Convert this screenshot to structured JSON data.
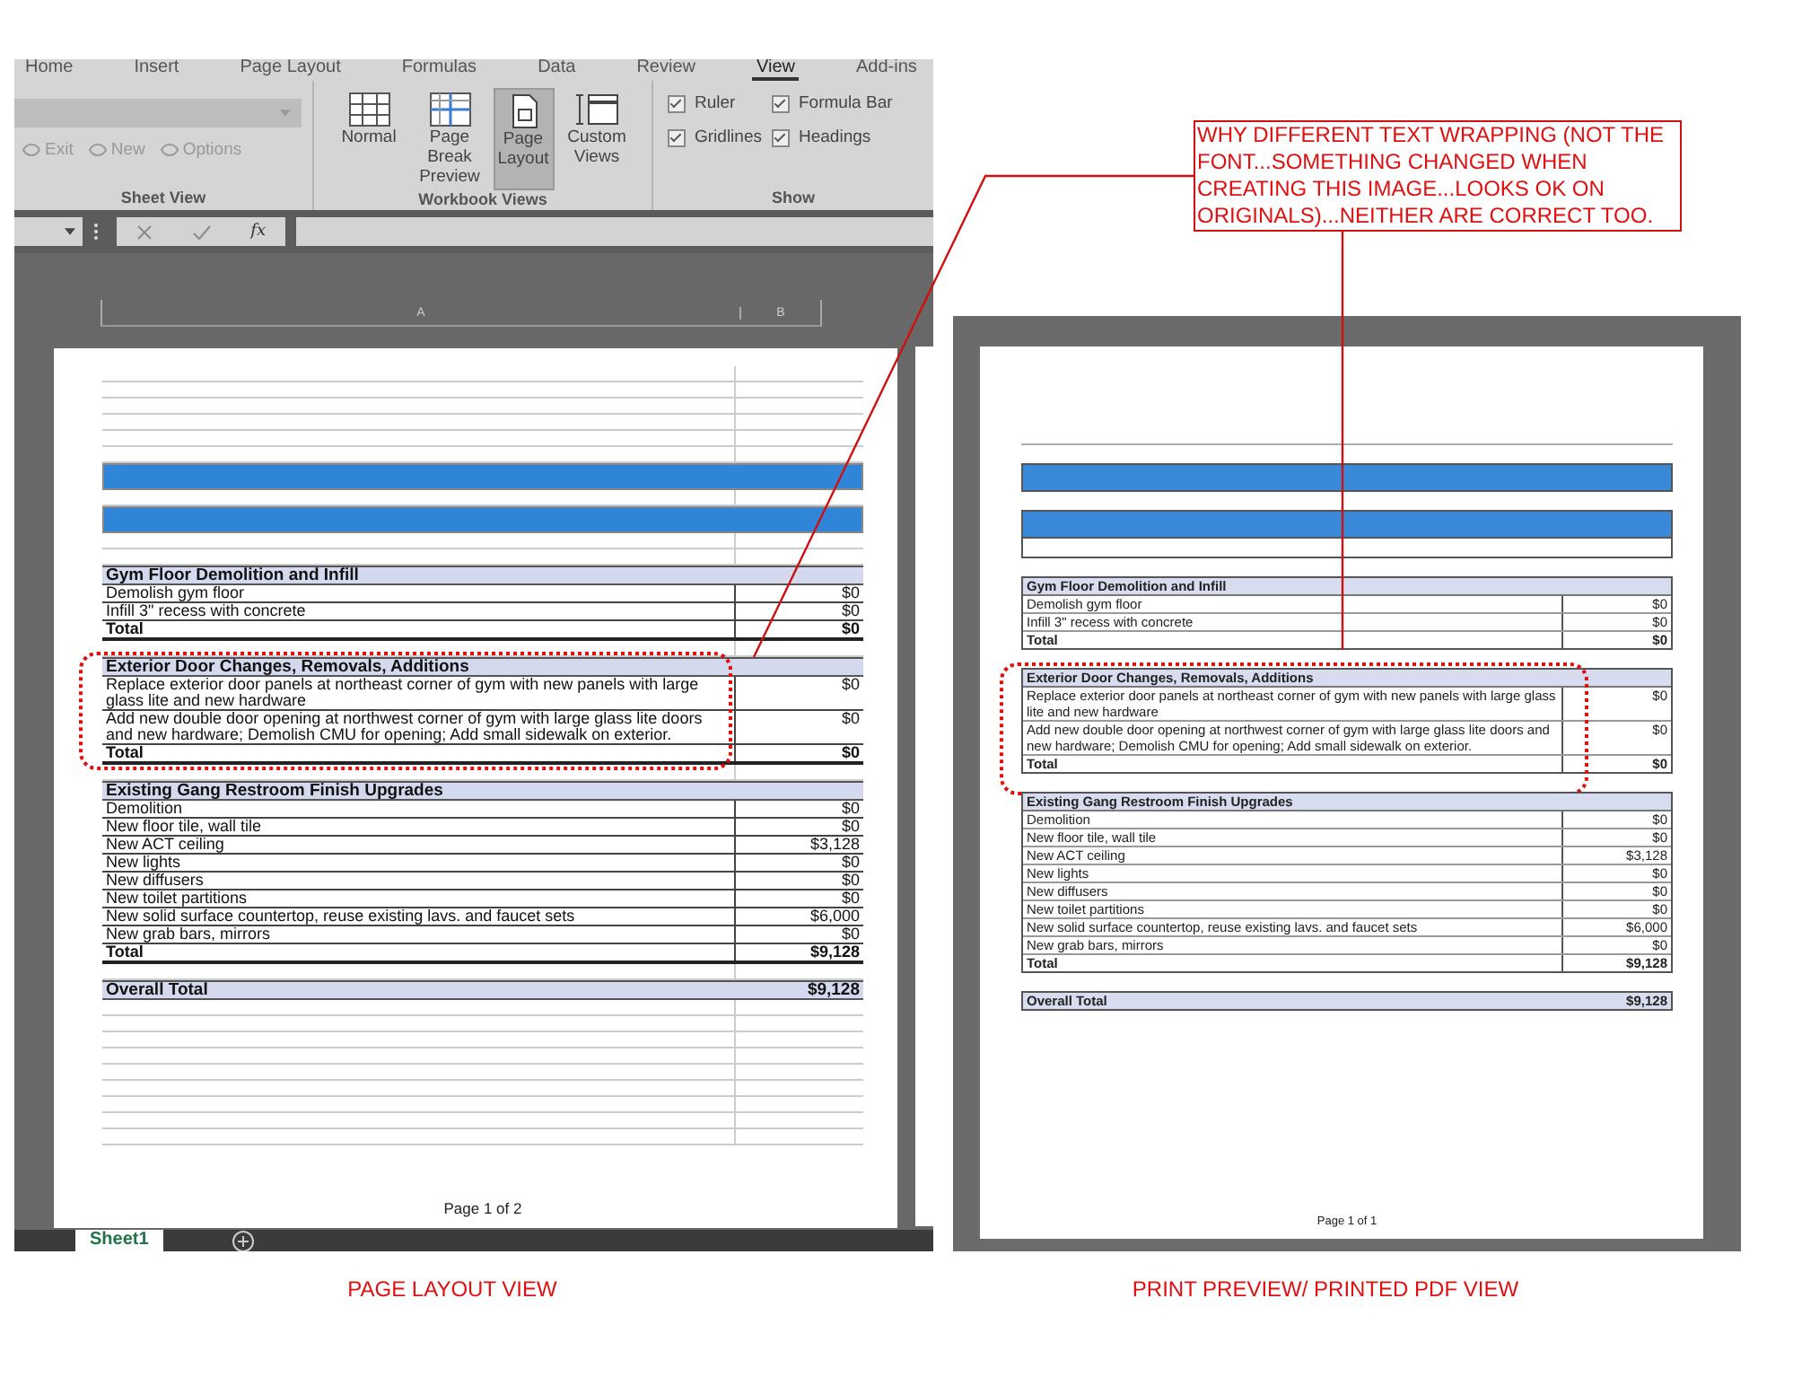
{
  "ribbon": {
    "tabs": [
      {
        "label": "Home",
        "selected": false
      },
      {
        "label": "Insert",
        "selected": false
      },
      {
        "label": "Page Layout",
        "selected": false
      },
      {
        "label": "Formulas",
        "selected": false
      },
      {
        "label": "Data",
        "selected": false
      },
      {
        "label": "Review",
        "selected": false
      },
      {
        "label": "View",
        "selected": true
      },
      {
        "label": "Add-ins",
        "selected": false
      }
    ],
    "sheet_view": {
      "items": [
        "Exit",
        "New",
        "Options"
      ],
      "label": "Sheet View"
    },
    "workbook_views": {
      "buttons": [
        {
          "label": "Normal",
          "selected": false
        },
        {
          "label": "Page Break Preview",
          "selected": false
        },
        {
          "label": "Page Layout",
          "selected": true
        },
        {
          "label": "Custom Views",
          "selected": false
        }
      ],
      "label": "Workbook Views"
    },
    "show": {
      "checkboxes": [
        {
          "label": "Ruler",
          "checked": true
        },
        {
          "label": "Formula Bar",
          "checked": true
        },
        {
          "label": "Gridlines",
          "checked": true
        },
        {
          "label": "Headings",
          "checked": true
        }
      ],
      "label": "Show"
    }
  },
  "formula_bar": {
    "function_label": "fx"
  },
  "column_headers": [
    "A",
    "B"
  ],
  "page_layout_view": {
    "sections": [
      {
        "title": "Gym Floor Demolition and Infill",
        "rows": [
          {
            "item": "Demolish gym floor",
            "amount": "$0"
          },
          {
            "item": "Infill 3\" recess with concrete",
            "amount": "$0"
          }
        ],
        "total_label": "Total",
        "total": "$0",
        "highlighted": false
      },
      {
        "title": "Exterior Door Changes, Removals, Additions",
        "rows": [
          {
            "item": "Replace exterior door panels at northeast corner of gym with new panels with large glass lite and new hardware",
            "amount": "$0"
          },
          {
            "item": "Add new double door opening at northwest corner of gym with large glass lite doors and new hardware; Demolish CMU for opening; Add small sidewalk on exterior.",
            "amount": "$0"
          }
        ],
        "total_label": "Total",
        "total": "$0",
        "highlighted": true
      },
      {
        "title": "Existing Gang Restroom Finish Upgrades",
        "rows": [
          {
            "item": "Demolition",
            "amount": "$0"
          },
          {
            "item": "New floor tile, wall tile",
            "amount": "$0"
          },
          {
            "item": "New ACT ceiling",
            "amount": "$3,128"
          },
          {
            "item": "New lights",
            "amount": "$0"
          },
          {
            "item": "New diffusers",
            "amount": "$0"
          },
          {
            "item": "New toilet partitions",
            "amount": "$0"
          },
          {
            "item": "New solid surface countertop, reuse existing lavs. and faucet sets",
            "amount": "$6,000"
          },
          {
            "item": "New grab bars, mirrors",
            "amount": "$0"
          }
        ],
        "total_label": "Total",
        "total": "$9,128",
        "highlighted": false
      }
    ],
    "overall_label": "Overall Total",
    "overall_total": "$9,128",
    "footer": "Page 1 of 2",
    "sheet_tab": "Sheet1"
  },
  "print_preview": {
    "sections": [
      {
        "title": "Gym Floor Demolition and Infill",
        "rows": [
          {
            "item": "Demolish gym floor",
            "amount": "$0"
          },
          {
            "item": "Infill 3\" recess with concrete",
            "amount": "$0"
          }
        ],
        "total_label": "Total",
        "total": "$0",
        "highlighted": false
      },
      {
        "title": "Exterior Door Changes, Removals, Additions",
        "rows": [
          {
            "item": "Replace exterior door panels at northeast corner of gym with new panels with large glass lite and new hardware",
            "amount": "$0"
          },
          {
            "item": "Add new double door opening at northwest corner of gym with large glass lite doors and new hardware; Demolish CMU for opening; Add small sidewalk on exterior.",
            "amount": "$0"
          }
        ],
        "total_label": "Total",
        "total": "$0",
        "highlighted": true
      },
      {
        "title": "Existing Gang Restroom Finish Upgrades",
        "rows": [
          {
            "item": "Demolition",
            "amount": "$0"
          },
          {
            "item": "New floor tile, wall tile",
            "amount": "$0"
          },
          {
            "item": "New ACT ceiling",
            "amount": "$3,128"
          },
          {
            "item": "New lights",
            "amount": "$0"
          },
          {
            "item": "New diffusers",
            "amount": "$0"
          },
          {
            "item": "New toilet partitions",
            "amount": "$0"
          },
          {
            "item": "New solid surface countertop, reuse existing lavs. and faucet sets",
            "amount": "$6,000"
          },
          {
            "item": "New grab bars, mirrors",
            "amount": "$0"
          }
        ],
        "total_label": "Total",
        "total": "$9,128",
        "highlighted": false
      }
    ],
    "overall_label": "Overall Total",
    "overall_total": "$9,128",
    "footer": "Page 1 of 1"
  },
  "annotation": "WHY DIFFERENT TEXT WRAPPING (NOT THE FONT...SOMETHING CHANGED WHEN CREATING THIS IMAGE...LOOKS OK ON ORIGINALS)...NEITHER ARE CORRECT TOO.",
  "captions": [
    "PAGE LAYOUT VIEW",
    "PRINT PREVIEW/ PRINTED PDF VIEW"
  ]
}
